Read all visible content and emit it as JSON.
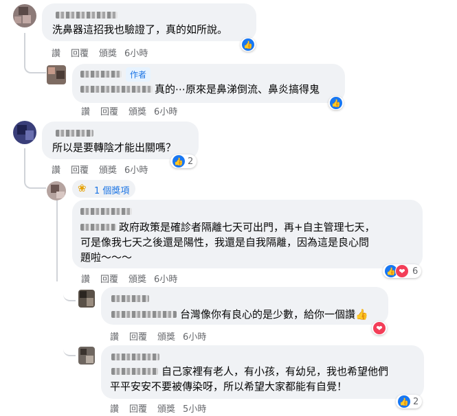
{
  "actions": {
    "like": "讚",
    "reply": "回覆",
    "award": "頒獎"
  },
  "comments": [
    {
      "text": "洗鼻器這招我也驗證了，真的如所說。",
      "time": "6小時"
    },
    {
      "author_badge": "作者",
      "text": "真的⋯原來是鼻涕倒流、鼻炎搞得鬼",
      "time": "6小時"
    },
    {
      "text": "所以是要轉陰才能出關嗎？",
      "time": "6小時",
      "reaction_count": "2"
    },
    {
      "award_label": "1 個獎項",
      "text_line1": "政府政策是確診者隔離七天可出門，再+自主管理七天，",
      "text_line2": "可是像我七天之後還是陽性，我還是自我隔離，因為這是良心問",
      "text_line3": "題啦～～～",
      "time": "6小時",
      "reaction_count": "6"
    },
    {
      "text": "台灣像你有良心的是少數，給你一個讚",
      "emoji": "👍",
      "time": "6小時"
    },
    {
      "text_line1": "自己家裡有老人，有小孩，有幼兒，我也希望他們",
      "text_line2": "平平安安不要被傳染呀，所以希望大家都能有自覺！",
      "time": "5小時",
      "reaction_count": "2"
    }
  ],
  "colors": {
    "like": "#1877f2",
    "love": "#f33e58",
    "link": "#1b74e4",
    "bubble": "#f0f2f5",
    "meta": "#65676b"
  }
}
